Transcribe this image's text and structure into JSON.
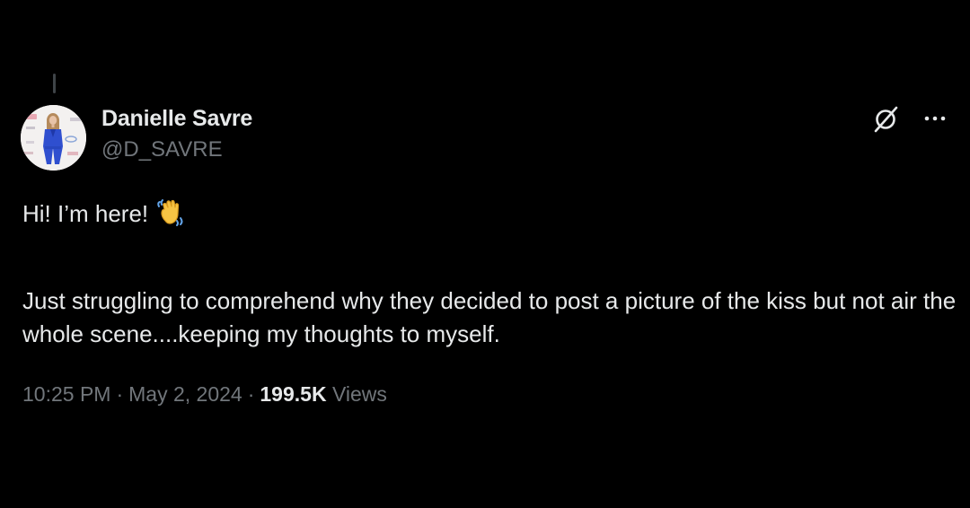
{
  "tweet": {
    "author": {
      "name": "Danielle Savre",
      "handle": "@D_SAVRE"
    },
    "text": {
      "line1": "Hi! I’m here!",
      "line1_emoji": "waving-hand",
      "body": "Just struggling to comprehend why they decided to post a picture of the kiss but not air the whole scene....keeping my thoughts to myself."
    },
    "meta": {
      "time": "10:25 PM",
      "separator": "·",
      "date": "May 2, 2024",
      "views_count": "199.5K",
      "views_label": "Views"
    },
    "icons": {
      "grok": "grok-icon",
      "more": "more-icon"
    },
    "colors": {
      "background": "#000000",
      "primary_text": "#e7e9ea",
      "secondary_text": "#71767b"
    }
  }
}
